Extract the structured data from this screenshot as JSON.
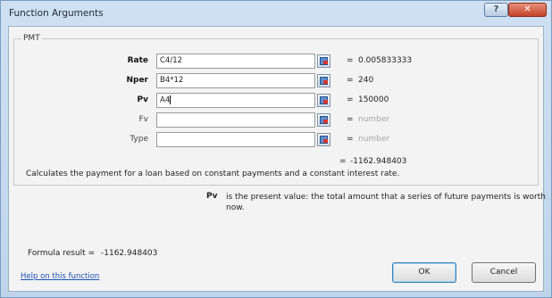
{
  "dialog": {
    "title": "Function Arguments"
  },
  "function_name": "PMT",
  "args": [
    {
      "label": "Rate",
      "value": "C4/12",
      "result": "0.005833333",
      "bold": true,
      "muted": false
    },
    {
      "label": "Nper",
      "value": "B4*12",
      "result": "240",
      "bold": true,
      "muted": false
    },
    {
      "label": "Pv",
      "value": "A4",
      "result": "150000",
      "bold": true,
      "muted": false,
      "focused": true
    },
    {
      "label": "Fv",
      "value": "",
      "result": "number",
      "bold": false,
      "muted": true
    },
    {
      "label": "Type",
      "value": "",
      "result": "number",
      "bold": false,
      "muted": true
    }
  ],
  "equals": "=",
  "overall_result": "-1162.948403",
  "description": "Calculates the payment for a loan based on constant payments and a constant interest rate.",
  "current_arg": {
    "name": "Pv",
    "text": "is the present value: the total amount that a series of future payments is worth now."
  },
  "formula_result_label": "Formula result =",
  "formula_result_value": "-1162.948403",
  "help_link": "Help on this function",
  "buttons": {
    "ok": "OK",
    "cancel": "Cancel"
  }
}
